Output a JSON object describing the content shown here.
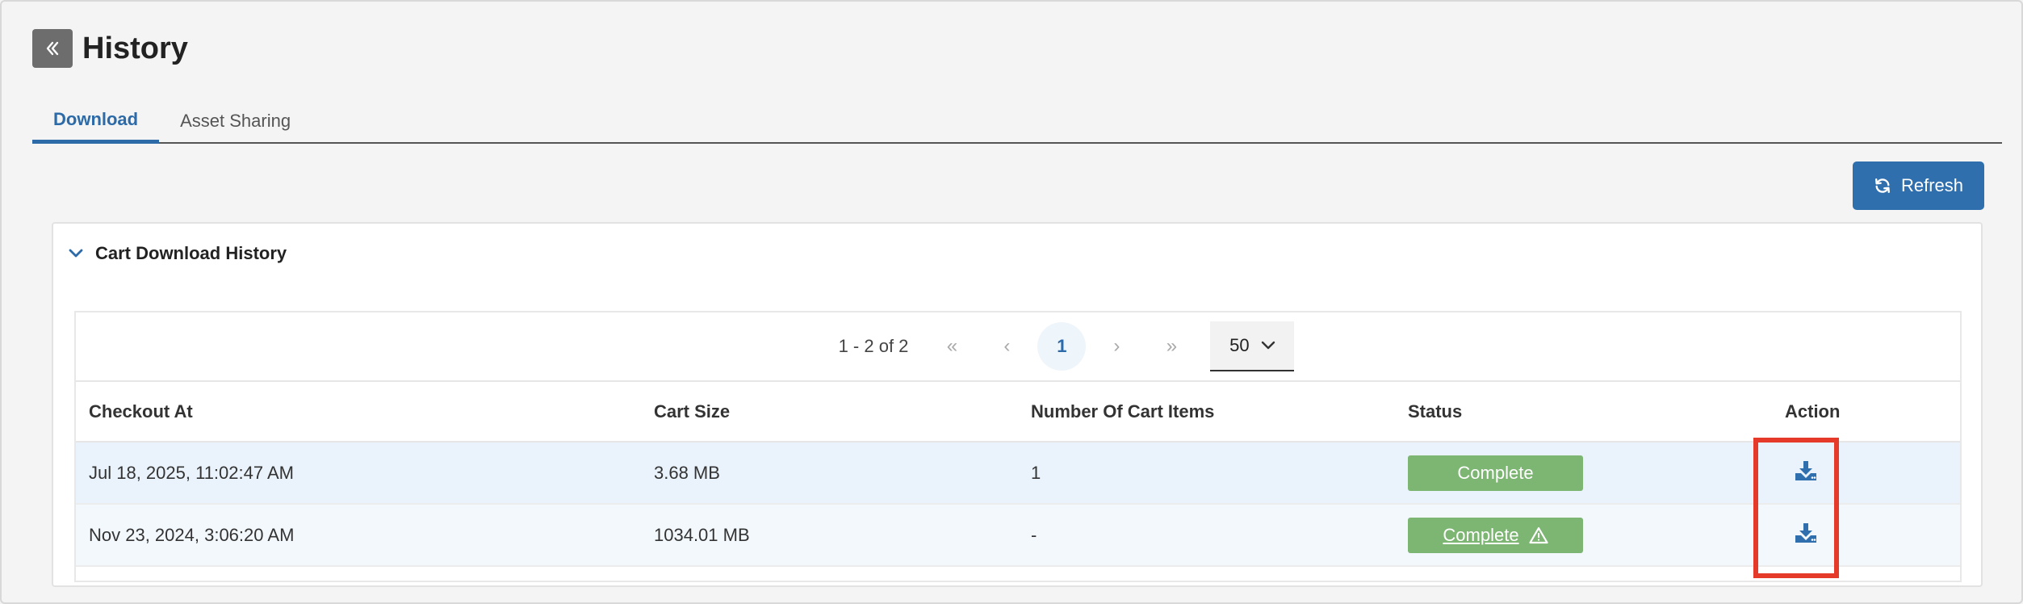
{
  "page": {
    "title": "History"
  },
  "tabs": [
    {
      "label": "Download",
      "active": true
    },
    {
      "label": "Asset Sharing",
      "active": false
    }
  ],
  "toolbar": {
    "refresh_label": "Refresh"
  },
  "panel": {
    "title": "Cart Download History"
  },
  "pagination": {
    "range": "1 - 2 of 2",
    "first": "«",
    "prev": "‹",
    "current_page": "1",
    "next": "›",
    "last": "»",
    "page_size": "50"
  },
  "table": {
    "headers": [
      "Checkout At",
      "Cart Size",
      "Number Of Cart Items",
      "Status",
      "Action"
    ],
    "rows": [
      {
        "checkout_at": "Jul 18, 2025, 11:02:47 AM",
        "cart_size": "3.68 MB",
        "items": "1",
        "status": "Complete",
        "warning": false
      },
      {
        "checkout_at": "Nov 23, 2024, 3:06:20 AM",
        "cart_size": "1034.01 MB",
        "items": "-",
        "status": "Complete",
        "warning": true
      }
    ]
  },
  "colors": {
    "accent": "#2f6fad",
    "status_complete": "#7db573",
    "highlight": "#e53a2a"
  },
  "icons": {
    "back": "double-chevron-left-icon",
    "refresh": "refresh-icon",
    "collapse": "chevron-down-icon",
    "download": "download-icon",
    "warning": "warning-triangle-icon"
  }
}
